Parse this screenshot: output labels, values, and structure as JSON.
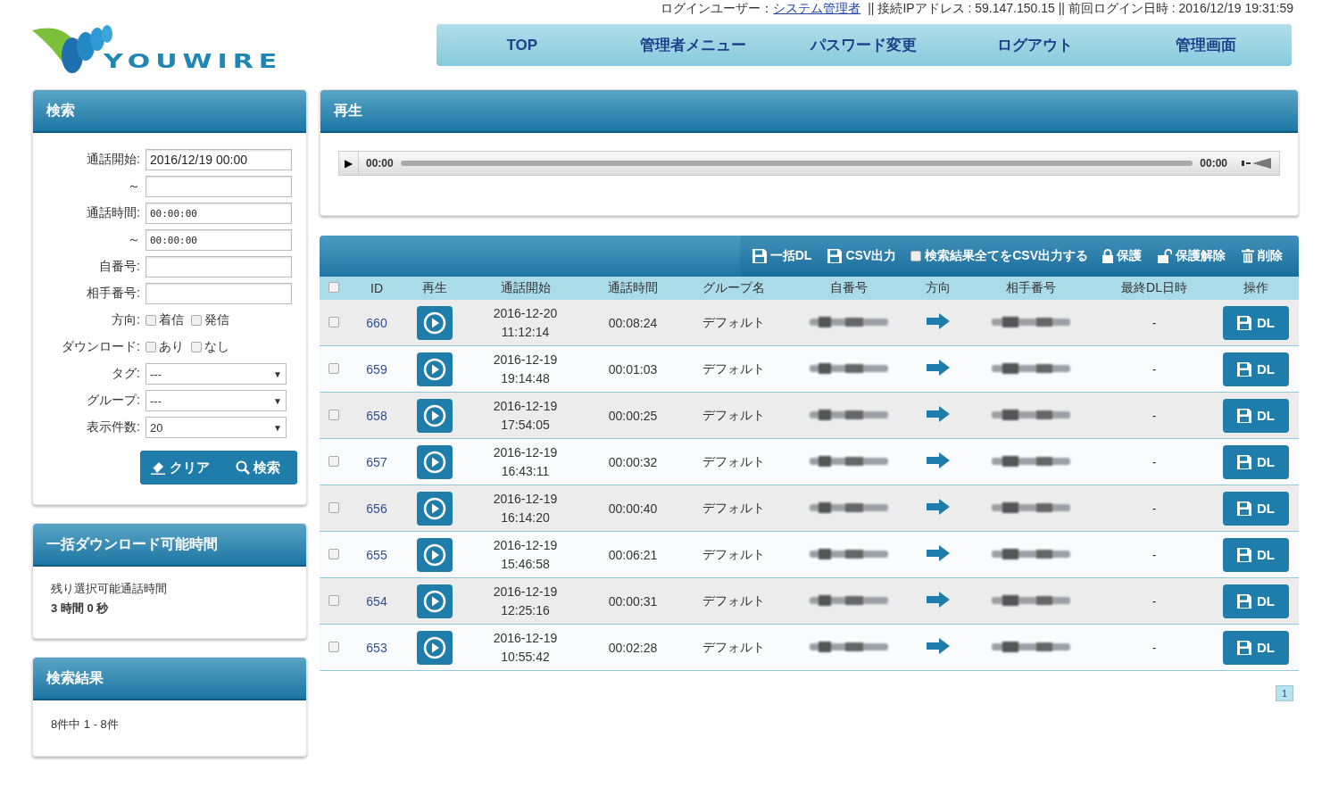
{
  "header": {
    "login_label": "ログインユーザー：",
    "user_link": "システム管理者",
    "info": "|| 接続IPアドレス : 59.147.150.15 || 前回ログイン日時 : 2016/12/19 19:31:59",
    "logo": "YOUWIRE"
  },
  "nav": [
    {
      "label": "TOP"
    },
    {
      "label": "管理者メニュー"
    },
    {
      "label": "パスワード変更"
    },
    {
      "label": "ログアウト"
    },
    {
      "label": "管理画面"
    }
  ],
  "search": {
    "title": "検索",
    "fields": [
      {
        "kind": "text",
        "label": "通話開始:",
        "value": "2016/12/19 00:00"
      },
      {
        "kind": "text",
        "label": "～"
      },
      {
        "kind": "mono",
        "label": "通話時間:",
        "value": "00:00:00"
      },
      {
        "kind": "mono",
        "label": "～",
        "value": "00:00:00"
      },
      {
        "kind": "text",
        "label": "自番号:"
      },
      {
        "kind": "text",
        "label": "相手番号:"
      },
      {
        "kind": "checks",
        "label": "方向:",
        "options": [
          {
            "label": "着信",
            "checked": false
          },
          {
            "label": "発信",
            "checked": false
          }
        ]
      },
      {
        "kind": "checks",
        "label": "ダウンロード:",
        "options": [
          {
            "label": "あり",
            "checked": false
          },
          {
            "label": "なし",
            "checked": false
          }
        ]
      },
      {
        "kind": "select",
        "label": "タグ:",
        "value": "---",
        "caret": "▼"
      },
      {
        "kind": "select",
        "label": "グループ:",
        "value": "---",
        "caret": "▼"
      },
      {
        "kind": "select",
        "label": "表示件数:",
        "value": "20",
        "caret": "▼"
      }
    ],
    "buttons": [
      {
        "kind": "clear",
        "label": "クリア"
      },
      {
        "kind": "search",
        "label": "検索"
      }
    ]
  },
  "bulk": {
    "title": "一括ダウンロード可能時間",
    "label": "残り選択可能通話時間",
    "value": "3 時間 0 秒"
  },
  "results": {
    "title": "検索結果",
    "summary": "8件中 1 - 8件"
  },
  "player": {
    "title": "再生",
    "play": "▶",
    "current": "00:00",
    "total": "00:00"
  },
  "toolbar": [
    {
      "kind": "save",
      "label": "一括DL"
    },
    {
      "kind": "save",
      "label": "CSV出力"
    },
    {
      "kind": "check",
      "label": "検索結果全てをCSV出力する",
      "checked": false
    },
    {
      "kind": "lock",
      "label": "保護"
    },
    {
      "kind": "unlock",
      "label": "保護解除"
    },
    {
      "kind": "trash",
      "label": "削除"
    }
  ],
  "table": {
    "all_checked": false,
    "columns": [
      "ID",
      "再生",
      "通話開始",
      "通話時間",
      "グループ名",
      "自番号",
      "方向",
      "相手番号",
      "最終DL日時",
      "操作"
    ],
    "rows": [
      {
        "checked": false,
        "id": "660",
        "date": "2016-12-20",
        "time": "11:12:14",
        "duration": "00:08:24",
        "group": "デフォルト",
        "last_dl": "-",
        "action": "DL"
      },
      {
        "checked": false,
        "id": "659",
        "date": "2016-12-19",
        "time": "19:14:48",
        "duration": "00:01:03",
        "group": "デフォルト",
        "last_dl": "-",
        "action": "DL"
      },
      {
        "checked": false,
        "id": "658",
        "date": "2016-12-19",
        "time": "17:54:05",
        "duration": "00:00:25",
        "group": "デフォルト",
        "last_dl": "-",
        "action": "DL"
      },
      {
        "checked": false,
        "id": "657",
        "date": "2016-12-19",
        "time": "16:43:11",
        "duration": "00:00:32",
        "group": "デフォルト",
        "last_dl": "-",
        "action": "DL"
      },
      {
        "checked": false,
        "id": "656",
        "date": "2016-12-19",
        "time": "16:14:20",
        "duration": "00:00:40",
        "group": "デフォルト",
        "last_dl": "-",
        "action": "DL"
      },
      {
        "checked": false,
        "id": "655",
        "date": "2016-12-19",
        "time": "15:46:58",
        "duration": "00:06:21",
        "group": "デフォルト",
        "last_dl": "-",
        "action": "DL"
      },
      {
        "checked": false,
        "id": "654",
        "date": "2016-12-19",
        "time": "12:25:16",
        "duration": "00:00:31",
        "group": "デフォルト",
        "last_dl": "-",
        "action": "DL"
      },
      {
        "checked": false,
        "id": "653",
        "date": "2016-12-19",
        "time": "10:55:42",
        "duration": "00:02:28",
        "group": "デフォルト",
        "last_dl": "-",
        "action": "DL"
      }
    ]
  },
  "pagination": [
    {
      "label": "1",
      "selected": true
    }
  ]
}
